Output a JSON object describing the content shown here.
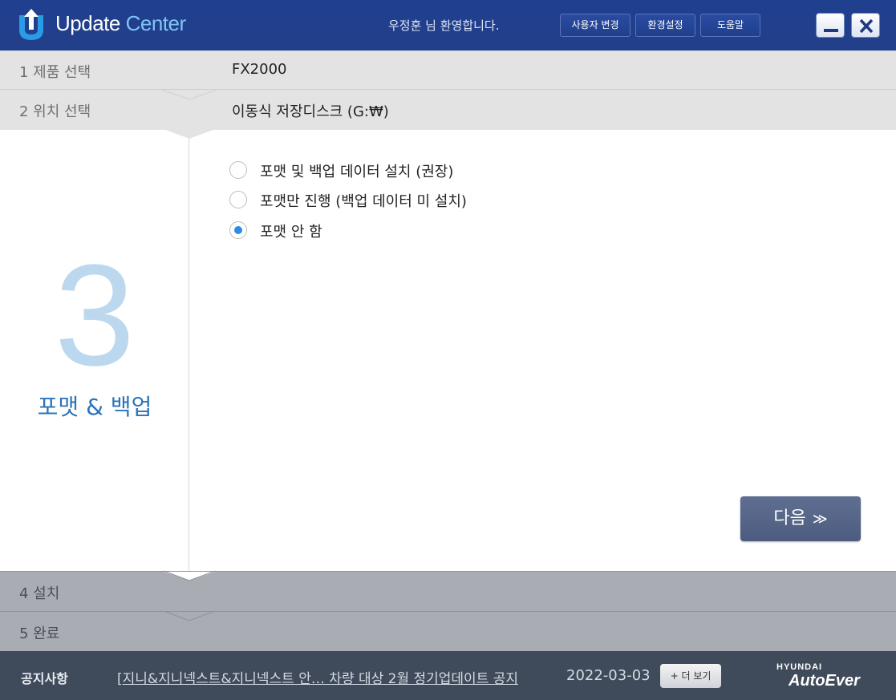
{
  "app": {
    "title_part1": "Update",
    "title_part2": "Center"
  },
  "header": {
    "welcome": "우정훈  님 환영합니다.",
    "buttons": {
      "change_user": "사용자 변경",
      "settings": "환경설정",
      "help": "도움말"
    }
  },
  "steps": [
    {
      "label": "1  제품 선택",
      "value": "FX2000",
      "state": "done"
    },
    {
      "label": "2  위치 선택",
      "value": "이동식 저장디스크 (G:₩)",
      "state": "done"
    },
    {
      "number": "3",
      "label": "포맷 & 백업",
      "state": "active"
    },
    {
      "label": "4  설치",
      "state": "pending"
    },
    {
      "label": "5  완료",
      "state": "pending"
    }
  ],
  "format_options": [
    {
      "label": "포맷 및 백업 데이터 설치 (권장)",
      "checked": false
    },
    {
      "label": "포맷만 진행 (백업 데이터 미 설치)",
      "checked": false
    },
    {
      "label": "포맷 안 함",
      "checked": true
    }
  ],
  "next_button": {
    "label": "다음",
    "icon": "double-chevron-down-icon"
  },
  "footer": {
    "notice_label": "공지사항",
    "notice_text": "[지니&지니넥스트&지니넥스트  안… 차량 대상 2월 정기업데이트 공지",
    "notice_date": "2022-03-03",
    "more_label": "+ 더 보기",
    "brand_top": "HYUNDAI",
    "brand_bottom": "AutoEver"
  },
  "colors": {
    "titlebar": "#223f8c",
    "accent": "#2a73bb",
    "big_number": "#bcd8ee",
    "radio_checked": "#2b8ce8",
    "next_button": "#56658a",
    "footer": "#3f4a5a"
  }
}
